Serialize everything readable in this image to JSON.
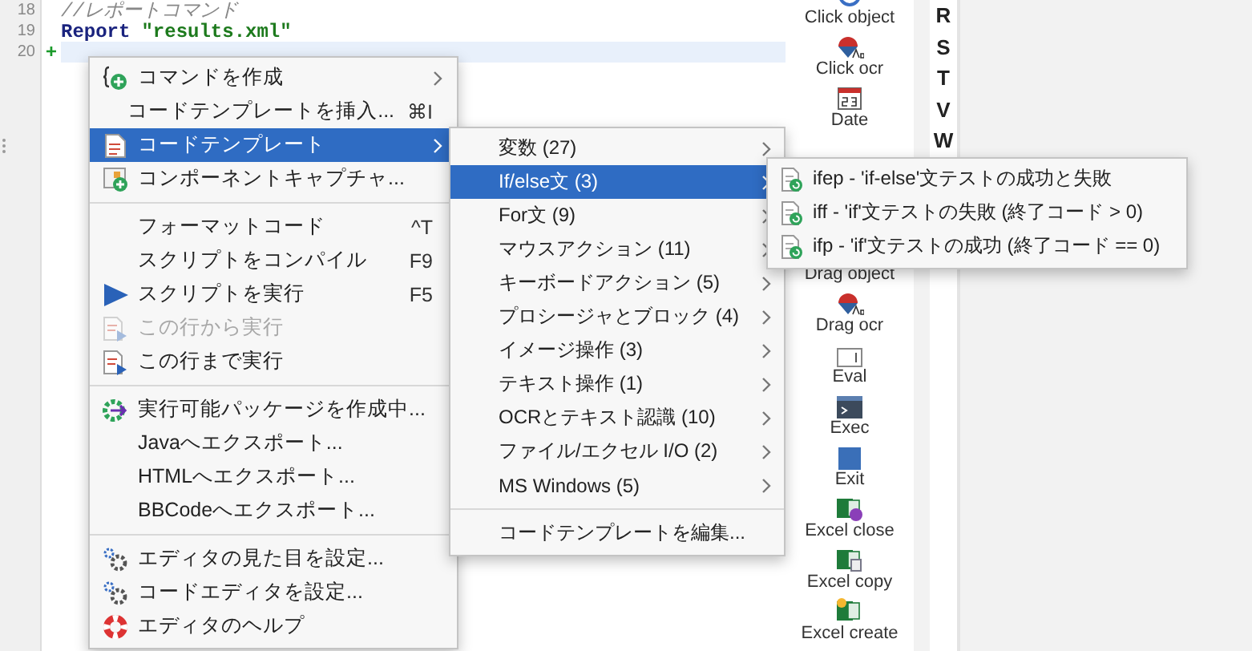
{
  "editor": {
    "lines": [
      {
        "number": "18",
        "kind": "comment",
        "text": "//レポートコマンド",
        "current": false
      },
      {
        "number": "19",
        "kind": "report",
        "keyword": "Report",
        "string": "\"results.xml\"",
        "current": false
      },
      {
        "number": "20",
        "kind": "empty",
        "marker": "+",
        "current": true
      }
    ]
  },
  "context_menu": {
    "groups": [
      [
        {
          "kind": "new",
          "label": "コマンドを作成",
          "submenu": true,
          "selected": false,
          "disabled": false
        },
        {
          "kind": "plain",
          "label": "コードテンプレートを挿入...",
          "shortcut": "⌘I",
          "submenu": false,
          "selected": false,
          "disabled": false
        },
        {
          "kind": "template",
          "label": "コードテンプレート",
          "submenu": true,
          "selected": true,
          "disabled": false
        },
        {
          "kind": "capture",
          "label": "コンポーネントキャプチャ...",
          "submenu": false,
          "selected": false,
          "disabled": false
        }
      ],
      [
        {
          "kind": "plain",
          "label": "フォーマットコード",
          "shortcut": "^T",
          "submenu": false,
          "selected": false,
          "disabled": false
        },
        {
          "kind": "plain",
          "label": "スクリプトをコンパイル",
          "shortcut": "F9",
          "submenu": false,
          "selected": false,
          "disabled": false
        },
        {
          "kind": "run",
          "label": "スクリプトを実行",
          "shortcut": "F5",
          "submenu": false,
          "selected": false,
          "disabled": false
        },
        {
          "kind": "runfrom",
          "label": "この行から実行",
          "submenu": false,
          "selected": false,
          "disabled": true
        },
        {
          "kind": "runfrom",
          "label": "この行まで実行",
          "submenu": false,
          "selected": false,
          "disabled": false
        }
      ],
      [
        {
          "kind": "package",
          "label": "実行可能パッケージを作成中...",
          "submenu": false,
          "selected": false,
          "disabled": false
        },
        {
          "kind": "plain",
          "label": "Javaへエクスポート...",
          "submenu": false,
          "selected": false,
          "disabled": false
        },
        {
          "kind": "plain",
          "label": "HTMLへエクスポート...",
          "submenu": false,
          "selected": false,
          "disabled": false
        },
        {
          "kind": "plain",
          "label": "BBCodeへエクスポート...",
          "submenu": false,
          "selected": false,
          "disabled": false
        }
      ],
      [
        {
          "kind": "settings",
          "label": "エディタの見た目を設定...",
          "submenu": false,
          "selected": false,
          "disabled": false
        },
        {
          "kind": "settings",
          "label": "コードエディタを設定...",
          "submenu": false,
          "selected": false,
          "disabled": false
        },
        {
          "kind": "help",
          "label": "エディタのヘルプ",
          "submenu": false,
          "selected": false,
          "disabled": false
        }
      ]
    ]
  },
  "template_menu": {
    "groups": [
      [
        {
          "label": "変数 (27)",
          "submenu": true,
          "selected": false,
          "disabled": false
        },
        {
          "label": "If/else文 (3)",
          "submenu": true,
          "selected": true,
          "disabled": false
        },
        {
          "label": "For文 (9)",
          "submenu": true,
          "selected": false,
          "disabled": false
        },
        {
          "label": "マウスアクション (11)",
          "submenu": true,
          "selected": false,
          "disabled": false
        },
        {
          "label": "キーボードアクション (5)",
          "submenu": true,
          "selected": false,
          "disabled": false
        },
        {
          "label": "プロシージャとブロック (4)",
          "submenu": true,
          "selected": false,
          "disabled": false
        },
        {
          "label": "イメージ操作 (3)",
          "submenu": true,
          "selected": false,
          "disabled": false
        },
        {
          "label": "テキスト操作 (1)",
          "submenu": true,
          "selected": false,
          "disabled": false
        },
        {
          "label": "OCRとテキスト認識 (10)",
          "submenu": true,
          "selected": false,
          "disabled": false
        },
        {
          "label": "ファイル/エクセル I/O (2)",
          "submenu": true,
          "selected": false,
          "disabled": false
        },
        {
          "label": "MS Windows (5)",
          "submenu": true,
          "selected": false,
          "disabled": false
        }
      ],
      [
        {
          "label": "コードテンプレートを編集...",
          "submenu": false,
          "selected": false,
          "disabled": false
        }
      ]
    ]
  },
  "ifelse_menu": {
    "groups": [
      [
        {
          "kind": "snippet",
          "label": "ifep - 'if-else'文テストの成功と失敗",
          "submenu": false,
          "selected": false,
          "disabled": false
        },
        {
          "kind": "snippet",
          "label": "iff - 'if'文テストの失敗 (終了コード > 0)",
          "submenu": false,
          "selected": false,
          "disabled": false
        },
        {
          "kind": "snippet",
          "label": "ifp - 'if'文テストの成功 (終了コード == 0)",
          "submenu": false,
          "selected": false,
          "disabled": false
        }
      ]
    ]
  },
  "palette": {
    "items": [
      {
        "kind": "click",
        "label": "Click object"
      },
      {
        "kind": "ocr",
        "label": "Click ocr"
      },
      {
        "kind": "date",
        "label": "Date"
      },
      {
        "kind": "screen"
      },
      {
        "kind": "covered"
      },
      {
        "kind": "covered",
        "label": "Drag object"
      },
      {
        "kind": "ocr",
        "label": "Drag ocr"
      },
      {
        "kind": "eval",
        "label": "Eval"
      },
      {
        "kind": "exec",
        "label": "Exec"
      },
      {
        "kind": "exit",
        "label": "Exit"
      },
      {
        "kind": "excelclose",
        "label": "Excel close"
      },
      {
        "kind": "excelcopy",
        "label": "Excel copy"
      },
      {
        "kind": "excelcreate",
        "label": "Excel create"
      }
    ]
  },
  "index_letters": [
    "R",
    "S",
    "T",
    "V",
    "W"
  ]
}
